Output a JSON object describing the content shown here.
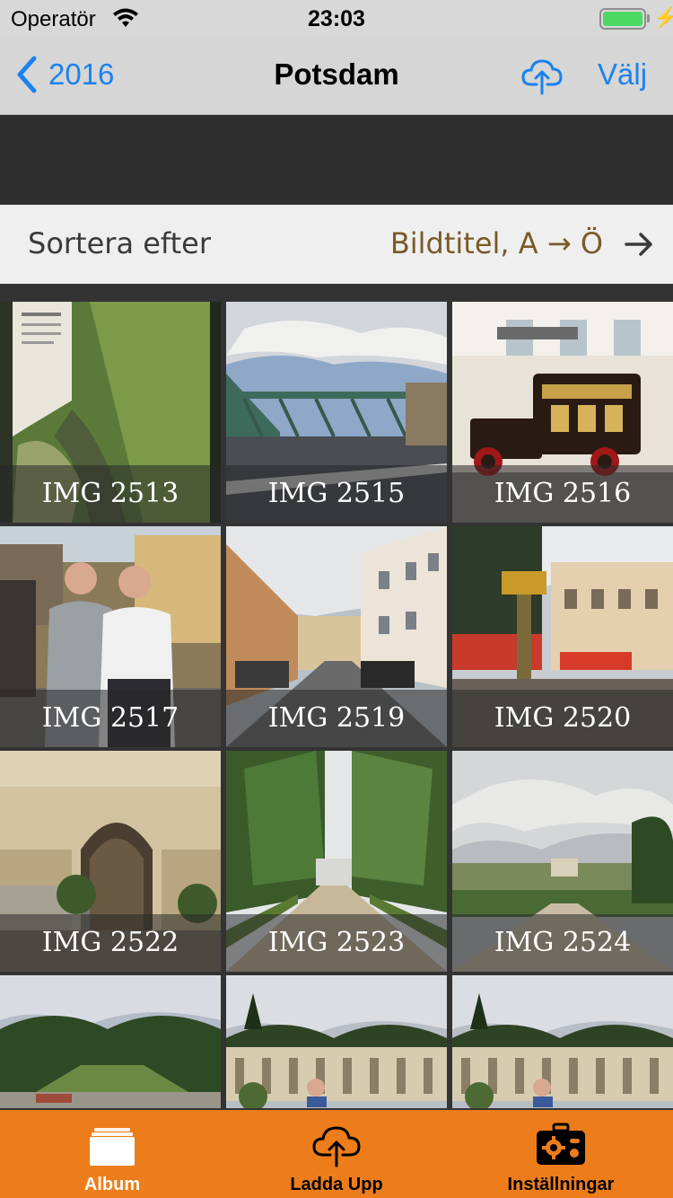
{
  "status_bar": {
    "carrier": "Operatör",
    "time": "23:03",
    "battery_level": 1.0
  },
  "nav": {
    "back_label": "2016",
    "title": "Potsdam",
    "upload_icon": "cloud-upload-icon",
    "select_label": "Välj"
  },
  "sort": {
    "label": "Sortera efter",
    "value": "Bildtitel, A → Ö"
  },
  "photos": [
    {
      "caption": "IMG 2513",
      "scene": "map-board"
    },
    {
      "caption": "IMG 2515",
      "scene": "bridge"
    },
    {
      "caption": "IMG 2516",
      "scene": "vintage-truck"
    },
    {
      "caption": "IMG 2517",
      "scene": "people-street"
    },
    {
      "caption": "IMG 2519",
      "scene": "street"
    },
    {
      "caption": "IMG 2520",
      "scene": "square"
    },
    {
      "caption": "IMG 2522",
      "scene": "archway"
    },
    {
      "caption": "IMG 2523",
      "scene": "tree-avenue"
    },
    {
      "caption": "IMG 2524",
      "scene": "park-terrace"
    },
    {
      "caption": "",
      "scene": "park-fountain"
    },
    {
      "caption": "",
      "scene": "colonnade"
    },
    {
      "caption": "",
      "scene": "colonnade"
    }
  ],
  "tabs": [
    {
      "label": "Album",
      "icon": "album-icon",
      "active": true
    },
    {
      "label": "Ladda Upp",
      "icon": "cloud-upload-icon",
      "active": false
    },
    {
      "label": "Inställningar",
      "icon": "settings-toolbox-icon",
      "active": false
    }
  ],
  "colors": {
    "accent_blue": "#1a82f0",
    "tab_bar_orange": "#ed7d1a",
    "tab_active": "#ffffff",
    "tab_inactive": "#000000",
    "sort_value_brown": "#7a5a26"
  }
}
